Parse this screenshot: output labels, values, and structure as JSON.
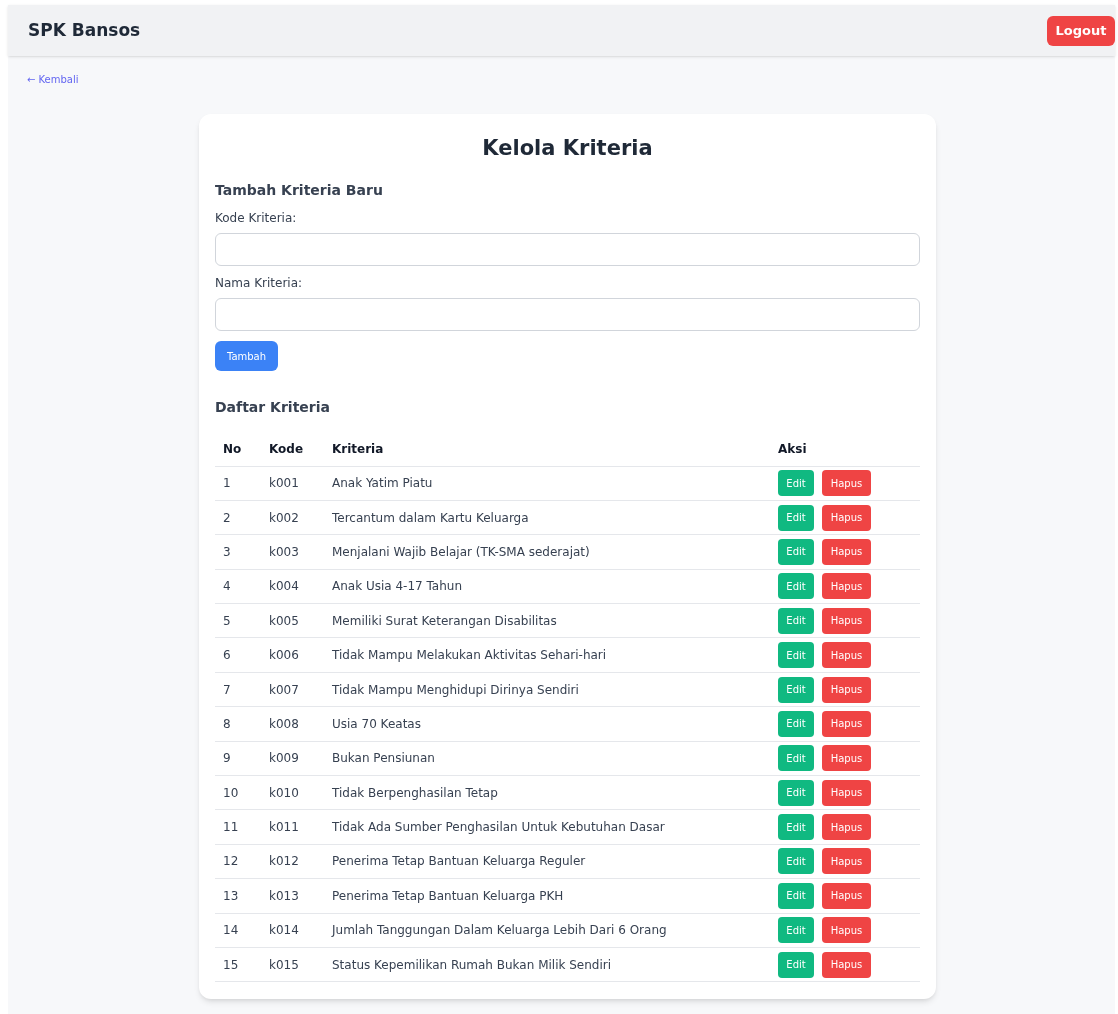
{
  "header": {
    "title": "SPK Bansos",
    "logout": "Logout"
  },
  "back_link": "← Kembali",
  "card": {
    "title": "Kelola Kriteria",
    "form": {
      "heading": "Tambah Kriteria Baru",
      "fields": [
        {
          "label": "Kode Kriteria:"
        },
        {
          "label": "Nama Kriteria:"
        }
      ],
      "submit": "Tambah"
    },
    "list": {
      "heading": "Daftar Kriteria",
      "columns": [
        "No",
        "Kode",
        "Kriteria",
        "Aksi"
      ],
      "rows": [
        {
          "no": "1",
          "kode": "k001",
          "kriteria": "Anak Yatim Piatu",
          "edit": "Edit",
          "hapus": "Hapus"
        },
        {
          "no": "2",
          "kode": "k002",
          "kriteria": "Tercantum dalam Kartu Keluarga",
          "edit": "Edit",
          "hapus": "Hapus"
        },
        {
          "no": "3",
          "kode": "k003",
          "kriteria": "Menjalani Wajib Belajar (TK-SMA sederajat)",
          "edit": "Edit",
          "hapus": "Hapus"
        },
        {
          "no": "4",
          "kode": "k004",
          "kriteria": "Anak Usia 4-17 Tahun",
          "edit": "Edit",
          "hapus": "Hapus"
        },
        {
          "no": "5",
          "kode": "k005",
          "kriteria": "Memiliki Surat Keterangan Disabilitas",
          "edit": "Edit",
          "hapus": "Hapus"
        },
        {
          "no": "6",
          "kode": "k006",
          "kriteria": "Tidak Mampu Melakukan Aktivitas Sehari-hari",
          "edit": "Edit",
          "hapus": "Hapus"
        },
        {
          "no": "7",
          "kode": "k007",
          "kriteria": "Tidak Mampu Menghidupi Dirinya Sendiri",
          "edit": "Edit",
          "hapus": "Hapus"
        },
        {
          "no": "8",
          "kode": "k008",
          "kriteria": "Usia 70 Keatas",
          "edit": "Edit",
          "hapus": "Hapus"
        },
        {
          "no": "9",
          "kode": "k009",
          "kriteria": "Bukan Pensiunan",
          "edit": "Edit",
          "hapus": "Hapus"
        },
        {
          "no": "10",
          "kode": "k010",
          "kriteria": "Tidak Berpenghasilan Tetap",
          "edit": "Edit",
          "hapus": "Hapus"
        },
        {
          "no": "11",
          "kode": "k011",
          "kriteria": "Tidak Ada Sumber Penghasilan Untuk Kebutuhan Dasar",
          "edit": "Edit",
          "hapus": "Hapus"
        },
        {
          "no": "12",
          "kode": "k012",
          "kriteria": "Penerima Tetap Bantuan Keluarga Reguler",
          "edit": "Edit",
          "hapus": "Hapus"
        },
        {
          "no": "13",
          "kode": "k013",
          "kriteria": "Penerima Tetap Bantuan Keluarga PKH",
          "edit": "Edit",
          "hapus": "Hapus"
        },
        {
          "no": "14",
          "kode": "k014",
          "kriteria": "Jumlah Tanggungan Dalam Keluarga Lebih Dari 6 Orang",
          "edit": "Edit",
          "hapus": "Hapus"
        },
        {
          "no": "15",
          "kode": "k015",
          "kriteria": "Status Kepemilikan Rumah Bukan Milik Sendiri",
          "edit": "Edit",
          "hapus": "Hapus"
        }
      ]
    }
  }
}
